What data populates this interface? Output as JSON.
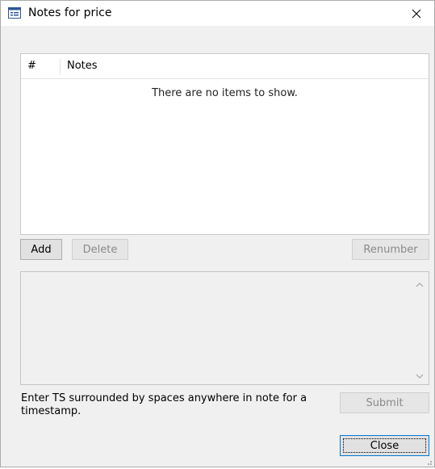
{
  "window": {
    "title": "Notes for price",
    "icon": "form-window-icon",
    "close_icon": "close-icon"
  },
  "list": {
    "columns": [
      "#",
      "Notes"
    ],
    "empty_message": "There are no items to show."
  },
  "buttons": {
    "add": "Add",
    "delete": "Delete",
    "renumber": "Renumber",
    "submit": "Submit",
    "close": "Close"
  },
  "note_editor": {
    "value": "",
    "hint": "Enter TS surrounded by spaces anywhere in note for a timestamp."
  },
  "colors": {
    "window_bg": "#f0f0f0",
    "list_bg": "#ffffff",
    "default_button_border": "#0078d7",
    "disabled_text": "#8a8a8a"
  }
}
